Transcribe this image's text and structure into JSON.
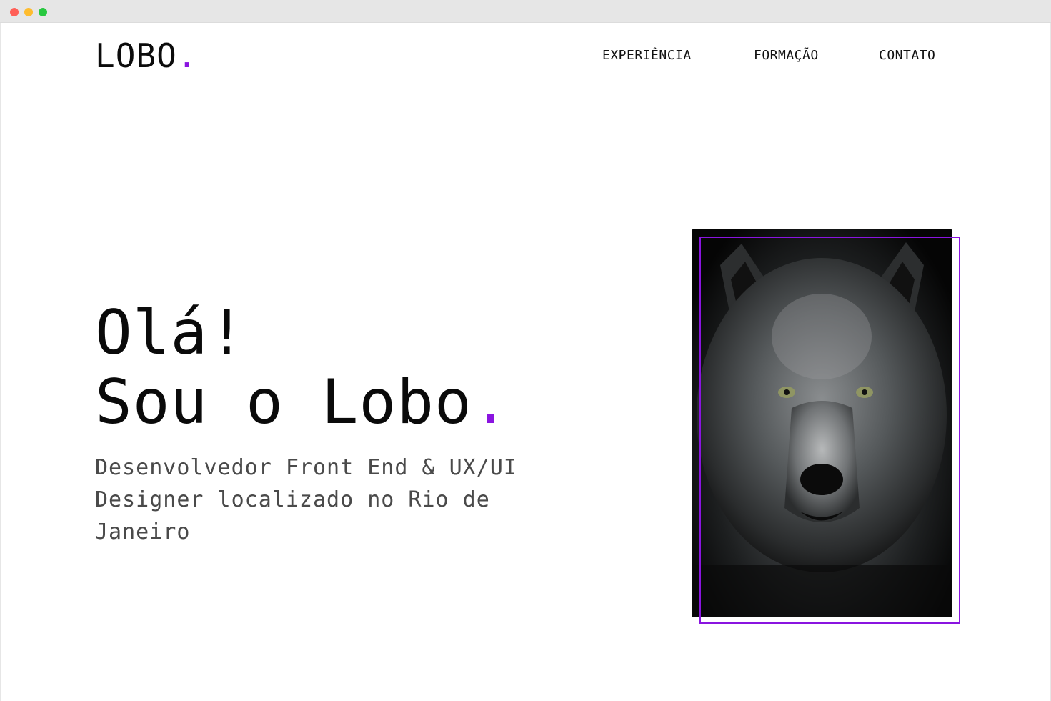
{
  "logo": {
    "text": "LOBO",
    "accent": "."
  },
  "nav": [
    {
      "label": "EXPERIÊNCIA"
    },
    {
      "label": "FORMAÇÃO"
    },
    {
      "label": "CONTATO"
    }
  ],
  "hero": {
    "greeting": "Olá!",
    "intro": "Sou o Lobo",
    "accent": ".",
    "description": "Desenvolvedor Front End & UX/UI Designer localizado no Rio de Janeiro"
  },
  "photo": {
    "alt": "Lobo",
    "icon": "wolf-photo"
  },
  "colors": {
    "accent": "#8a14e0",
    "text": "#111111",
    "subtext": "#4a4a4a"
  }
}
